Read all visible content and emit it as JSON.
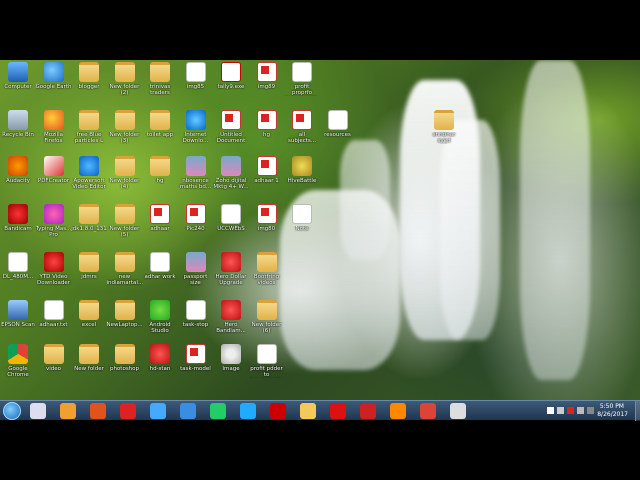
{
  "desktop_icons": [
    {
      "label": "Computer",
      "icon": "computer-icon",
      "kind": "g-pc"
    },
    {
      "label": "Google Earth",
      "icon": "google-earth-icon",
      "kind": "g-earth"
    },
    {
      "label": "blogger",
      "icon": "folder-icon",
      "kind": "g-folder"
    },
    {
      "label": "New folder\n(2)",
      "icon": "folder-icon",
      "kind": "g-folder"
    },
    {
      "label": "trinivas\ntraders",
      "icon": "folder-icon",
      "kind": "g-folder"
    },
    {
      "label": "img85",
      "icon": "document-icon",
      "kind": "g-doc"
    },
    {
      "label": "tally9.exe",
      "icon": "tally-icon",
      "kind": "g-tally"
    },
    {
      "label": "img89",
      "icon": "pdf-icon",
      "kind": "g-pdf"
    },
    {
      "label": "profit proprfo\nincorporatio",
      "icon": "document-icon",
      "kind": "g-doc"
    },
    {
      "label": "Recycle Bin",
      "icon": "recycle-bin-icon",
      "kind": "g-recycle"
    },
    {
      "label": "Mozilla\nFirefox",
      "icon": "firefox-icon",
      "kind": "g-firefox"
    },
    {
      "label": "free Blue\nparticles L",
      "icon": "folder-icon",
      "kind": "g-folder"
    },
    {
      "label": "New folder\n(3)",
      "icon": "folder-icon",
      "kind": "g-folder"
    },
    {
      "label": "toilet app",
      "icon": "folder-icon",
      "kind": "g-folder"
    },
    {
      "label": "Internet\nDownlo...",
      "icon": "internet-download-icon",
      "kind": "g-ie"
    },
    {
      "label": "Untitled\nDocument",
      "icon": "pdf-icon",
      "kind": "g-pdf"
    },
    {
      "label": "hg",
      "icon": "pdf-icon",
      "kind": "g-pdf"
    },
    {
      "label": "all\nsubjects...",
      "icon": "pdf-icon",
      "kind": "g-pdf"
    },
    {
      "label": "resources",
      "icon": "document-icon",
      "kind": "g-doc"
    },
    {
      "label": "shridhar syed\nali",
      "icon": "folder-icon",
      "kind": "g-folder"
    },
    {
      "label": "Audacity",
      "icon": "audacity-icon",
      "kind": "g-audacity"
    },
    {
      "label": "PDFCreator",
      "icon": "pdfcreator-icon",
      "kind": "g-pdfc"
    },
    {
      "label": "Apowersoft\nVideo Editor",
      "icon": "apowersoft-icon",
      "kind": "g-apower"
    },
    {
      "label": "New folder\n(4)",
      "icon": "folder-icon",
      "kind": "g-folder"
    },
    {
      "label": "hg",
      "icon": "folder-icon",
      "kind": "g-folder"
    },
    {
      "label": "nbosence\nmaths bd...",
      "icon": "photo-icon",
      "kind": "g-photo"
    },
    {
      "label": "Zoho dijital\nMktg 4+ W...",
      "icon": "photo-icon",
      "kind": "g-photo"
    },
    {
      "label": "adhaar 1",
      "icon": "pdf-icon",
      "kind": "g-pdf"
    },
    {
      "label": "HiveBattle",
      "icon": "bug-icon",
      "kind": "g-bug"
    },
    {
      "label": "Bandicam",
      "icon": "bandicam-icon",
      "kind": "g-bandi"
    },
    {
      "label": "Typing Mas...\nPro",
      "icon": "typing-master-icon",
      "kind": "g-typing"
    },
    {
      "label": "jdk1.8.0_131",
      "icon": "folder-icon",
      "kind": "g-folder"
    },
    {
      "label": "New folder\n(5)",
      "icon": "folder-icon",
      "kind": "g-folder"
    },
    {
      "label": "adhaar",
      "icon": "pdf-icon",
      "kind": "g-pdf"
    },
    {
      "label": "Pic240",
      "icon": "pdf-icon",
      "kind": "g-pdf"
    },
    {
      "label": "UCCWEbS",
      "icon": "document-icon",
      "kind": "g-doc"
    },
    {
      "label": "img80",
      "icon": "pdf-icon",
      "kind": "g-pdf"
    },
    {
      "label": "Note",
      "icon": "document-icon",
      "kind": "g-doc"
    },
    {
      "label": "DL_480M...",
      "icon": "document-icon",
      "kind": "g-doc"
    },
    {
      "label": "YTD Video\nDownloader",
      "icon": "ytd-icon",
      "kind": "g-ytd"
    },
    {
      "label": "jdmrs",
      "icon": "folder-icon",
      "kind": "g-folder"
    },
    {
      "label": "new\nindiamartal...",
      "icon": "folder-icon",
      "kind": "g-folder"
    },
    {
      "label": "adhar work",
      "icon": "document-icon",
      "kind": "g-doc"
    },
    {
      "label": "passport size\nphoto",
      "icon": "photo-icon",
      "kind": "g-photo"
    },
    {
      "label": "Hero Dollar\nUpgrade",
      "icon": "app-icon",
      "kind": "g-red"
    },
    {
      "label": "Bootfring\nvideos",
      "icon": "folder-icon",
      "kind": "g-folder"
    },
    {
      "label": "EPSON Scan",
      "icon": "epson-scan-icon",
      "kind": "g-epson"
    },
    {
      "label": "adhaar.txt",
      "icon": "document-icon",
      "kind": "g-doc"
    },
    {
      "label": "excel",
      "icon": "folder-icon",
      "kind": "g-folder"
    },
    {
      "label": "NewLaptop...",
      "icon": "folder-icon",
      "kind": "g-folder"
    },
    {
      "label": "Android\nStudio",
      "icon": "android-studio-icon",
      "kind": "g-green"
    },
    {
      "label": "task-stop",
      "icon": "document-icon",
      "kind": "g-doc"
    },
    {
      "label": "Hero\nBandlam...",
      "icon": "app-icon",
      "kind": "g-red"
    },
    {
      "label": "New folder\n(6)",
      "icon": "folder-icon",
      "kind": "g-folder"
    },
    {
      "label": "Google\nChrome",
      "icon": "chrome-icon",
      "kind": "g-chrome"
    },
    {
      "label": "video",
      "icon": "folder-icon",
      "kind": "g-folder"
    },
    {
      "label": "New folder",
      "icon": "folder-icon",
      "kind": "g-folder"
    },
    {
      "label": "photoshop",
      "icon": "folder-icon",
      "kind": "g-folder"
    },
    {
      "label": "hd-stan",
      "icon": "app-icon",
      "kind": "g-red"
    },
    {
      "label": "task-model",
      "icon": "pdf-icon",
      "kind": "g-pdf"
    },
    {
      "label": "Image",
      "icon": "cd-icon",
      "kind": "g-cd"
    },
    {
      "label": "profit pdder to\nincorporatio",
      "icon": "document-icon",
      "kind": "g-doc"
    }
  ],
  "taskbar": {
    "pinned": [
      {
        "name": "windows-security-icon",
        "color": "#dde"
      },
      {
        "name": "windows-media-icon",
        "color": "#f0a030"
      },
      {
        "name": "firefox-icon",
        "color": "#e2521d"
      },
      {
        "name": "acrobat-icon",
        "color": "#d22"
      },
      {
        "name": "app-icon",
        "color": "#4af"
      },
      {
        "name": "google-earth-icon",
        "color": "#3a8de0"
      },
      {
        "name": "video-editor-icon",
        "color": "#2c6"
      },
      {
        "name": "app-icon",
        "color": "#2af"
      },
      {
        "name": "tally-icon",
        "color": "#c00"
      },
      {
        "name": "explorer-icon",
        "color": "#f3c95a"
      },
      {
        "name": "bandicam-icon",
        "color": "#d11"
      },
      {
        "name": "recorder-icon",
        "color": "#c22"
      },
      {
        "name": "vlc-icon",
        "color": "#f80"
      },
      {
        "name": "chrome-icon",
        "color": "#db4437"
      },
      {
        "name": "window-icon",
        "color": "#ddd"
      }
    ],
    "clock": {
      "time": "5:50 PM",
      "date": "8/26/2017"
    }
  }
}
